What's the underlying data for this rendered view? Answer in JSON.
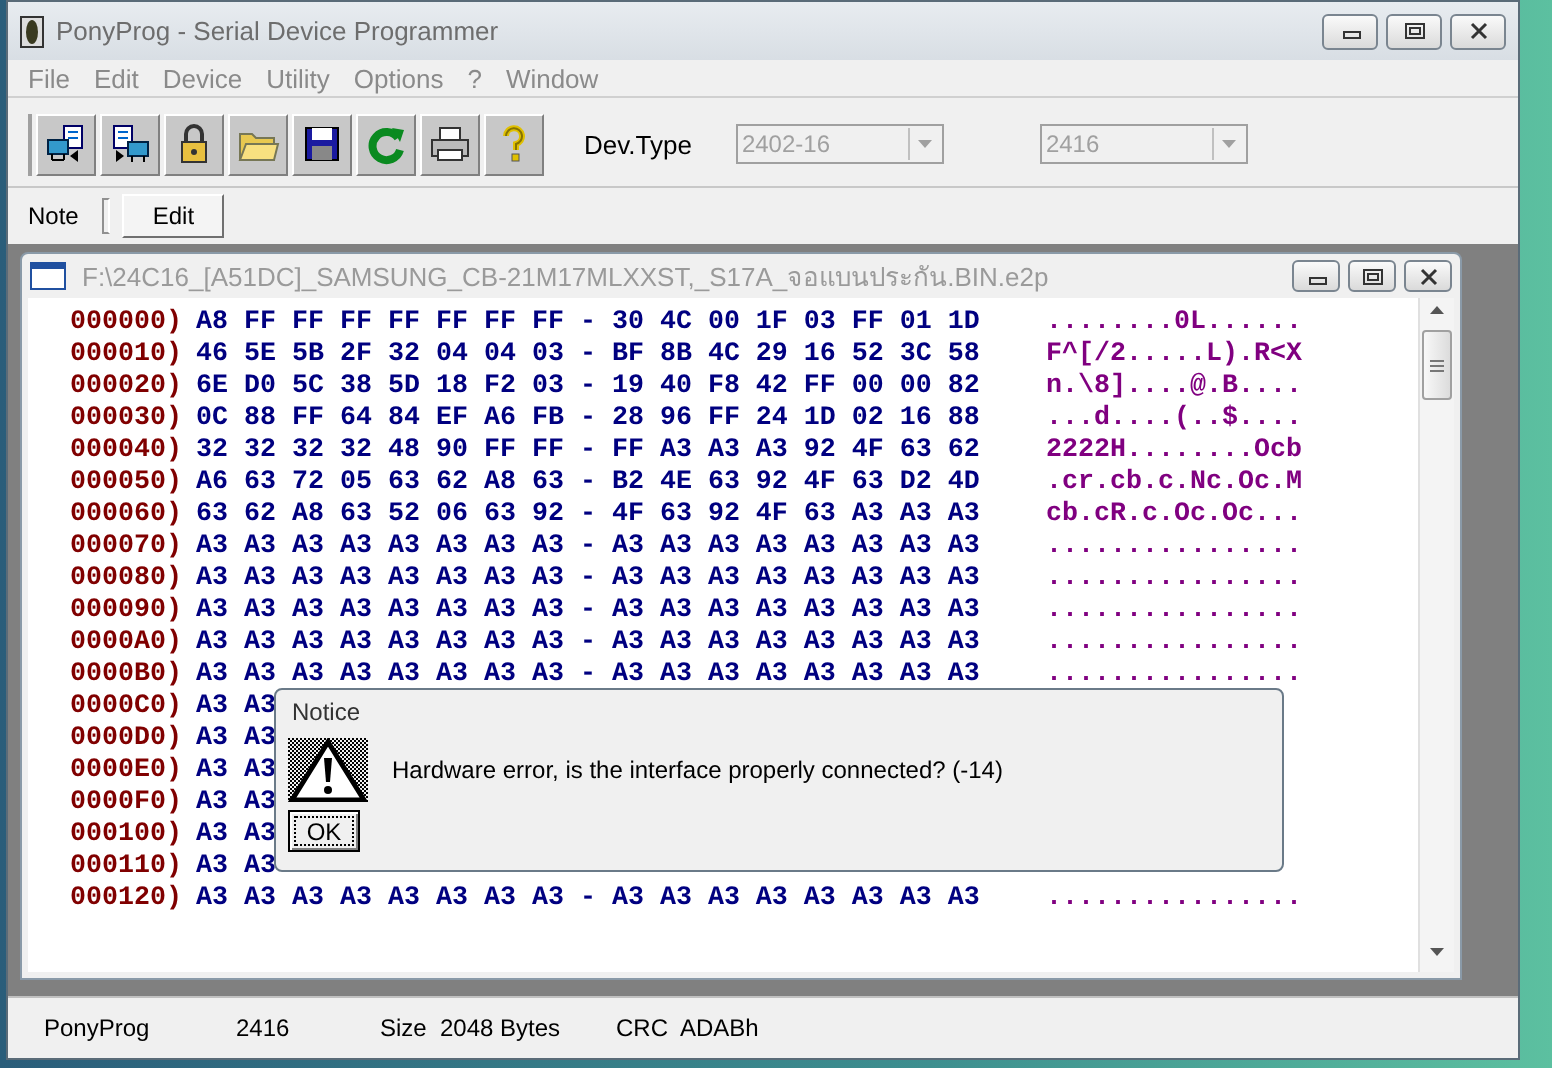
{
  "window": {
    "title": "PonyProg - Serial Device Programmer"
  },
  "menu": [
    "File",
    "Edit",
    "Device",
    "Utility",
    "Options",
    "?",
    "Window"
  ],
  "device_type": {
    "label": "Dev.Type",
    "family": {
      "value": "2402-16",
      "disabled": true
    },
    "model": {
      "value": "2416",
      "disabled": true
    }
  },
  "note": {
    "label": "Note",
    "button": "Edit"
  },
  "editor": {
    "title": "F:\\24C16_[A51DC]_SAMSUNG_CB-21M17MLXXST,_S17A_จอแบนประกัน.BIN.e2p",
    "active": false,
    "rows": [
      {
        "address": "000000)",
        "bytes": "A8 FF FF FF FF FF FF FF - 30 4C 00 1F 03 FF 01 1D",
        "ascii": "........0L......"
      },
      {
        "address": "000010)",
        "bytes": "46 5E 5B 2F 32 04 04 03 - BF 8B 4C 29 16 52 3C 58",
        "ascii": "F^[/2.....L).R<X"
      },
      {
        "address": "000020)",
        "bytes": "6E D0 5C 38 5D 18 F2 03 - 19 40 F8 42 FF 00 00 82",
        "ascii": "n.\\8]....@.B...."
      },
      {
        "address": "000030)",
        "bytes": "0C 88 FF 64 84 EF A6 FB - 28 96 FF 24 1D 02 16 88",
        "ascii": "...d....(..$...."
      },
      {
        "address": "000040)",
        "bytes": "32 32 32 32 48 90 FF FF - FF A3 A3 A3 92 4F 63 62",
        "ascii": "2222H........Ocb"
      },
      {
        "address": "000050)",
        "bytes": "A6 63 72 05 63 62 A8 63 - B2 4E 63 92 4F 63 D2 4D",
        "ascii": ".cr.cb.c.Nc.Oc.M"
      },
      {
        "address": "000060)",
        "bytes": "63 62 A8 63 52 06 63 92 - 4F 63 92 4F 63 A3 A3 A3",
        "ascii": "cb.cR.c.Oc.Oc..."
      },
      {
        "address": "000070)",
        "bytes": "A3 A3 A3 A3 A3 A3 A3 A3 - A3 A3 A3 A3 A3 A3 A3 A3",
        "ascii": "................"
      },
      {
        "address": "000080)",
        "bytes": "A3 A3 A3 A3 A3 A3 A3 A3 - A3 A3 A3 A3 A3 A3 A3 A3",
        "ascii": "................"
      },
      {
        "address": "000090)",
        "bytes": "A3 A3 A3 A3 A3 A3 A3 A3 - A3 A3 A3 A3 A3 A3 A3 A3",
        "ascii": "................"
      },
      {
        "address": "0000A0)",
        "bytes": "A3 A3 A3 A3 A3 A3 A3 A3 - A3 A3 A3 A3 A3 A3 A3 A3",
        "ascii": "................"
      },
      {
        "address": "0000B0)",
        "bytes": "A3 A3 A3 A3 A3 A3 A3 A3 - A3 A3 A3 A3 A3 A3 A3 A3",
        "ascii": "................"
      },
      {
        "address": "0000C0)",
        "bytes": "A3 A3"
      },
      {
        "address": "0000D0)",
        "bytes": "A3 A3"
      },
      {
        "address": "0000E0)",
        "bytes": "A3 A3"
      },
      {
        "address": "0000F0)",
        "bytes": "A3 A3"
      },
      {
        "address": "000100)",
        "bytes": "A3 A3"
      },
      {
        "address": "000110)",
        "bytes": "A3 A3"
      },
      {
        "address": "000120)",
        "bytes": "A3 A3 A3 A3 A3 A3 A3 A3 - A3 A3 A3 A3 A3 A3 A3 A3",
        "ascii": "................"
      }
    ]
  },
  "dialog": {
    "title": "Notice",
    "message": "Hardware error, is the interface properly connected? (-14)",
    "button": "OK"
  },
  "status_bar": [
    "PonyProg",
    "2416",
    "Size  2048 Bytes",
    "CRC  ADABh"
  ]
}
